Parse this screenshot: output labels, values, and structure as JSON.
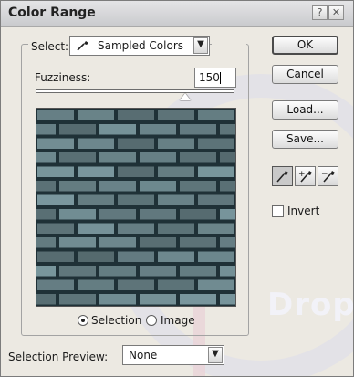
{
  "window": {
    "title": "Color Range"
  },
  "select": {
    "label": "Select:",
    "value": "Sampled Colors"
  },
  "fuzziness": {
    "label": "Fuzziness:",
    "value": "150",
    "level_max": 200
  },
  "view_options": {
    "selection": "Selection",
    "image": "Image",
    "selected": "selection"
  },
  "selection_preview": {
    "label": "Selection Preview:",
    "value": "None"
  },
  "buttons": {
    "ok": "OK",
    "cancel": "Cancel",
    "load": "Load...",
    "save": "Save..."
  },
  "eyedroppers": [
    "eyedropper-icon",
    "eyedropper-plus-icon",
    "eyedropper-minus-icon"
  ],
  "invert": {
    "label": "Invert",
    "checked": false
  },
  "watermark": {
    "text": "Drop"
  },
  "colors": {
    "brick": "#6f8a90",
    "mortar": "#1f3137",
    "dialog": "#ece9e2"
  }
}
